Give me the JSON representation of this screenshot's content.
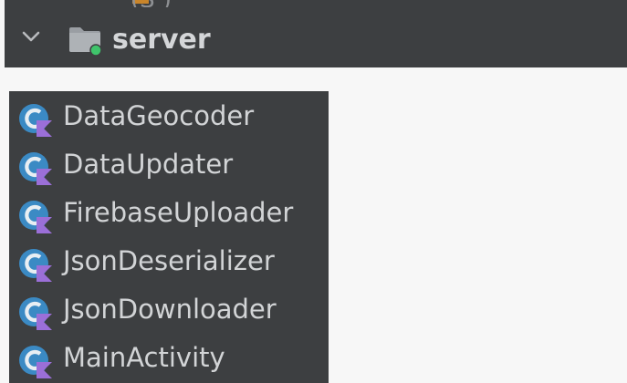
{
  "folder": {
    "name": "server",
    "cut_text_above": "(S            )",
    "icons": {
      "toggle": "chevron-down-icon",
      "folder": "folder-icon"
    }
  },
  "classes": [
    {
      "name": "DataGeocoder",
      "icon": "kotlin-class-icon"
    },
    {
      "name": "DataUpdater",
      "icon": "kotlin-class-icon"
    },
    {
      "name": "FirebaseUploader",
      "icon": "kotlin-class-icon"
    },
    {
      "name": "JsonDeserializer",
      "icon": "kotlin-class-icon"
    },
    {
      "name": "JsonDownloader",
      "icon": "kotlin-class-icon"
    },
    {
      "name": "MainActivity",
      "icon": "kotlin-class-icon"
    }
  ],
  "colors": {
    "panel_bg": "#3d3f41",
    "page_bg": "#f7f7f7",
    "text": "#d2d4d6",
    "class_icon_blue": "#3b8ac4",
    "kotlin_purple": "#9b6fd8",
    "folder_gray": "#9a9ea3",
    "vcs_green": "#3fc46b"
  }
}
